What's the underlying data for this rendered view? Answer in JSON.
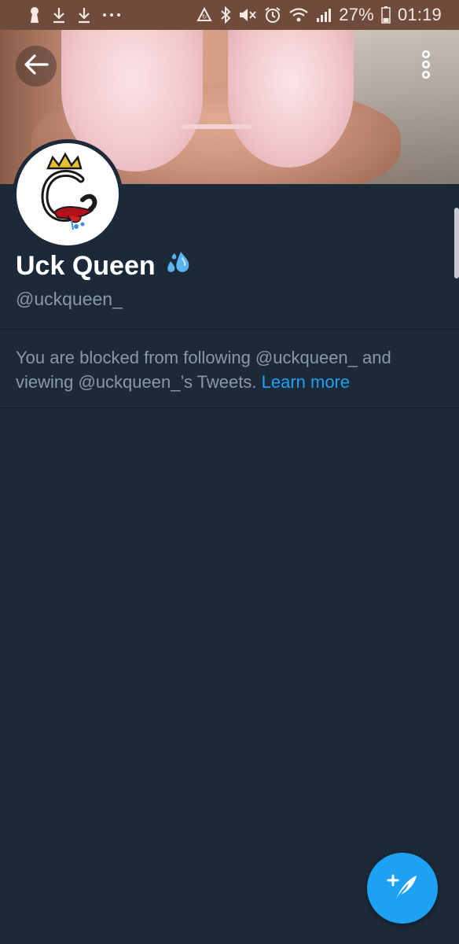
{
  "status_bar": {
    "left_icons": [
      "keyhole-icon",
      "download-icon",
      "download-icon",
      "more-notifications-icon"
    ],
    "right_icons": [
      "recycle-icon",
      "bluetooth-icon",
      "mute-icon",
      "alarm-icon",
      "wifi-icon",
      "signal-icon",
      "battery-icon"
    ],
    "battery_percent": "27%",
    "time": "01:19"
  },
  "header": {
    "back_icon": "arrow-left-icon",
    "more_icon": "vertical-dots-icon"
  },
  "profile": {
    "display_name": "Uck Queen",
    "name_emoji": "sweat-droplets-icon",
    "handle": "@uckqueen_"
  },
  "blocked_notice": {
    "message": "You are blocked from following @uckqueen_ and viewing @uckqueen_’s Tweets.",
    "link_label": "Learn more"
  },
  "compose_button": {
    "icon": "compose-tweet-icon"
  },
  "colors": {
    "background": "#1c2938",
    "status_bar": "#6e4b3a",
    "accent": "#1da1f2",
    "secondary_text": "#8899a6",
    "primary_text": "#ffffff"
  }
}
